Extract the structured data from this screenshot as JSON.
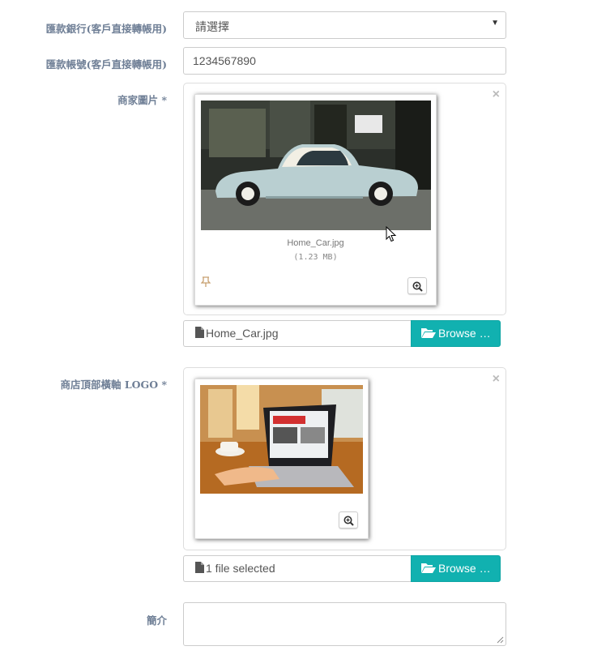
{
  "bank": {
    "label": "匯款銀行(客戶直接轉帳用)",
    "selected": "請選擇"
  },
  "account": {
    "label": "匯款帳號(客戶直接轉帳用)",
    "value": "1234567890"
  },
  "merchant_image": {
    "label": "商家圖片 *",
    "file_caption": "Home_Car.jpg",
    "file_size": "(1.23 MB)",
    "file_input_text": "Home_Car.jpg",
    "browse_label": "Browse …"
  },
  "banner_logo": {
    "label": "商店頂部橫軸 LOGO *",
    "file_input_text": "1 file selected",
    "browse_label": "Browse …"
  },
  "intro": {
    "label": "簡介",
    "value": ""
  },
  "colors": {
    "label_text": "#6f7f96",
    "browse_button": "#11b1b0"
  },
  "icons": [
    "chevron-down-icon",
    "close-icon",
    "zoom-in-icon",
    "drag-handle-icon",
    "file-icon",
    "folder-open-icon",
    "mouse-cursor-icon",
    "resize-grip-icon"
  ]
}
